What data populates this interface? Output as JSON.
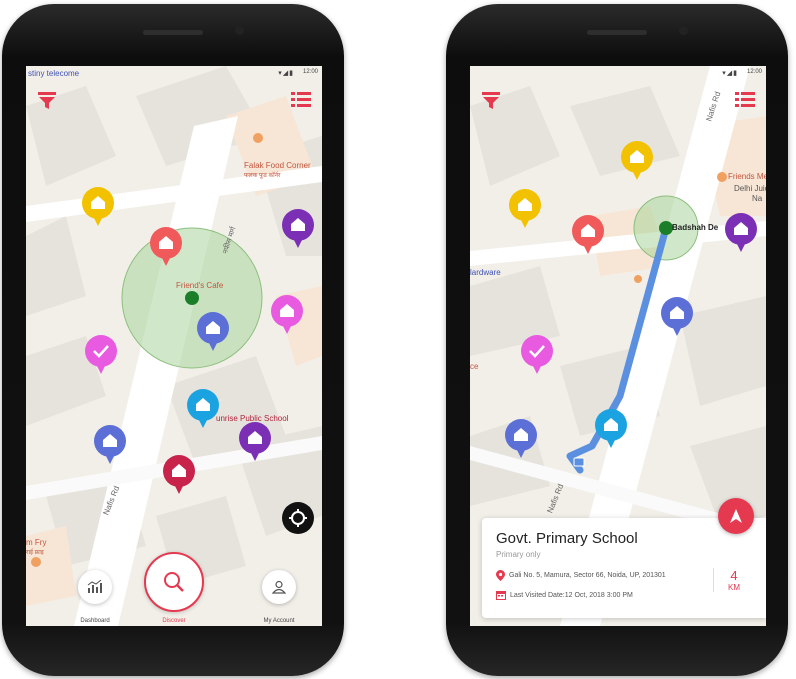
{
  "colors": {
    "brand": "#e53950",
    "route": "#5b8fe0",
    "radius_fill": "#a9d69c",
    "center_dot": "#1b7f2a"
  },
  "left": {
    "status": {
      "carrier": "stiny telecome",
      "clock": "12:00",
      "icons": "▾◢▮"
    },
    "labels": {
      "food_corner": "Falak Food Corner",
      "food_corner_sub": "फलक फूड कॉर्नर",
      "cafe": "Friend's Cafe",
      "school": "unrise Public School",
      "road": "Nafis Rd",
      "road_vertical": "नफीस मार्ग",
      "fry": "m Fry",
      "fry_sub": "राई फ्राइ"
    },
    "nav": {
      "dashboard": "Dashboard",
      "discover": "Discover",
      "account": "My Account"
    },
    "icons": {
      "filter": "filter-icon",
      "list": "list-icon",
      "locate": "locate-icon",
      "dashboard": "chart-icon",
      "discover": "search-icon",
      "account": "user-icon"
    }
  },
  "right": {
    "status": {
      "clock": "12:00",
      "icons": "▾◢▮"
    },
    "labels": {
      "road_top": "Nafis Rd",
      "road_bottom": "Nafis Rd",
      "friends_med": "Friends Medi",
      "delhi": "Delhi Juic",
      "na": "Na",
      "badshah": "Badshah De",
      "hardware": "lardware",
      "ce": "ce"
    },
    "card": {
      "title": "Govt. Primary School",
      "subtitle": "Primary only",
      "address": "Gali No. 5, Mamura, Sector 66, Noida, UP, 201301",
      "last_visited": "Last Visited Date:12 Oct, 2018  3:00 PM",
      "distance": "4",
      "unit": "KM"
    },
    "icons": {
      "filter": "filter-icon",
      "list": "list-icon",
      "navigate": "navigate-icon",
      "location": "location-pin-icon",
      "calendar": "calendar-icon"
    }
  }
}
